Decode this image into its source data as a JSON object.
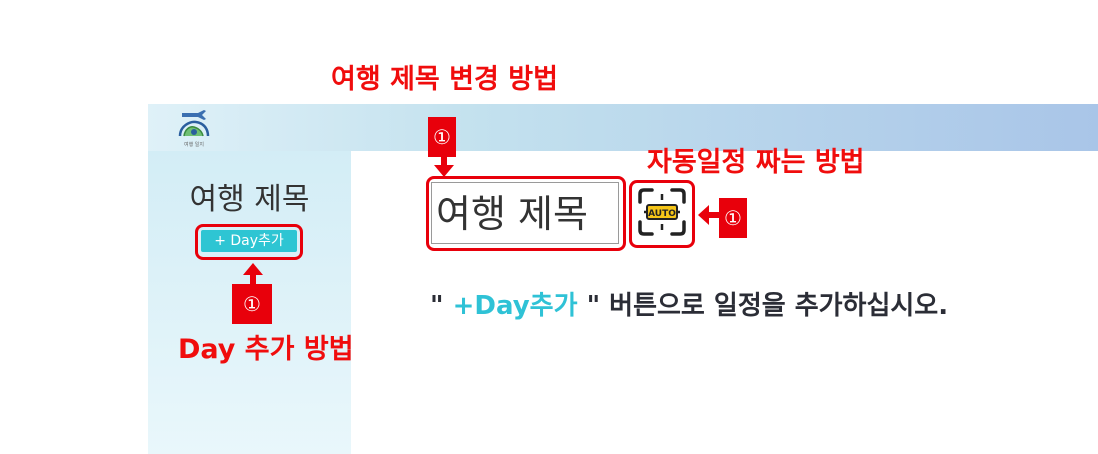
{
  "app": {
    "logo_icon": "airplane-globe-logo",
    "logo_text": "여행 일지",
    "sidebar_title": "여행 제목",
    "add_day_label": "+ Day추가",
    "title_value": "여행 제목",
    "auto_icon": "auto-schedule-icon",
    "auto_label": "AUTO"
  },
  "annotations": {
    "title_change_heading": "여행 제목 변경 방법",
    "auto_heading": "자동일정 짜는 방법",
    "add_day_heading": "Day 추가 방법",
    "step_marker": "①",
    "instruction": {
      "prefix": "\" ",
      "accent": "+Day추가",
      "suffix": " \" 버튼으로 일정을 추가하십시오."
    }
  },
  "colors": {
    "annotation_red": "#e8000b",
    "button_cyan": "#2ec5d3",
    "header_gradient_start": "#dff1f8",
    "header_gradient_end": "#a9c5e8"
  }
}
